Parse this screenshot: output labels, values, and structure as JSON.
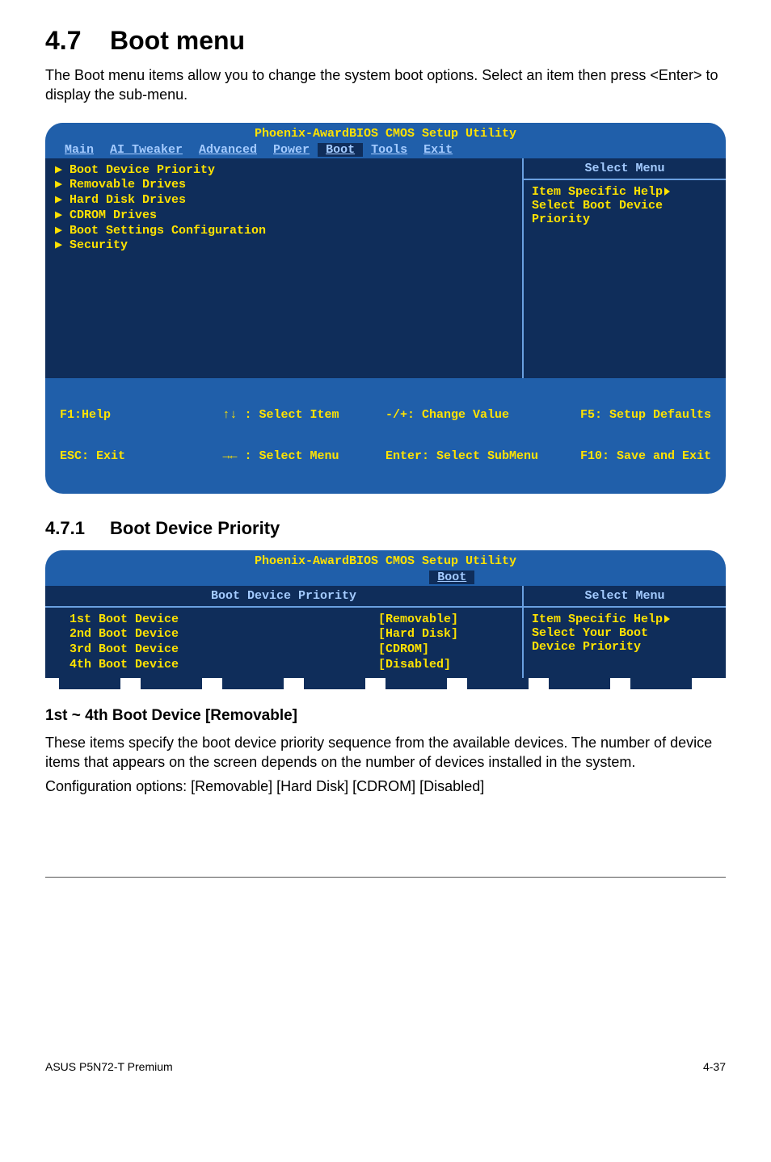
{
  "section": {
    "number": "4.7",
    "title": "Boot menu",
    "intro": "The Boot menu items allow you to change the system boot options. Select an item then press <Enter> to display the sub-menu."
  },
  "bios1": {
    "header": "Phoenix-AwardBIOS CMOS Setup Utility",
    "tabs": [
      "Main",
      "AI Tweaker",
      "Advanced",
      "Power",
      "Boot",
      "Tools",
      "Exit"
    ],
    "activeTab": "Boot",
    "items": [
      "Boot Device Priority",
      "Removable Drives",
      "Hard Disk Drives",
      "CDROM Drives",
      "Boot Settings Configuration",
      "Security"
    ],
    "sideTitle": "Select Menu",
    "sideLines": [
      "Item Specific Help",
      "",
      "Select Boot Device",
      "Priority"
    ],
    "footer": {
      "c1a": "F1:Help",
      "c1b": "ESC: Exit",
      "c2a": "↑↓ : Select Item",
      "c2b": "→← : Select Menu",
      "c3a": "-/+: Change Value",
      "c3b": "Enter: Select SubMenu",
      "c4a": "F5: Setup Defaults",
      "c4b": "F10: Save and Exit"
    }
  },
  "subsection": {
    "number": "4.7.1",
    "title": "Boot Device Priority"
  },
  "bios2": {
    "header": "Phoenix-AwardBIOS CMOS Setup Utility",
    "tab": "Boot",
    "subtitle": "Boot Device Priority",
    "rows": [
      {
        "label": "1st Boot Device",
        "value": "[Removable]"
      },
      {
        "label": "2nd Boot Device",
        "value": "[Hard Disk]"
      },
      {
        "label": "3rd Boot Device",
        "value": "[CDROM]"
      },
      {
        "label": "4th Boot Device",
        "value": "[Disabled]"
      }
    ],
    "sideTitle": "Select Menu",
    "sideLines": [
      "Item Specific Help",
      "",
      "Select Your Boot",
      "Device Priority"
    ]
  },
  "field": {
    "heading": "1st ~ 4th Boot Device [Removable]",
    "p1": "These items specify the boot device priority sequence from the available devices. The number of device items that appears on the screen depends on the number of devices installed in the system.",
    "p2": "Configuration options: [Removable] [Hard Disk] [CDROM] [Disabled]"
  },
  "footer": {
    "left": "ASUS P5N72-T Premium",
    "right": "4-37"
  }
}
